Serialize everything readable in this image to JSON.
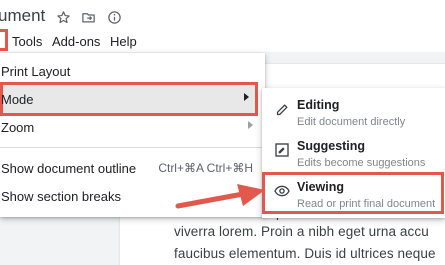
{
  "title_bar": {
    "doc_title": "ument",
    "icons": [
      "star-icon",
      "move-to-folder-icon",
      "document-status-icon"
    ]
  },
  "menu_bar": {
    "items": [
      "Tools",
      "Add-ons",
      "Help"
    ]
  },
  "view_menu": {
    "items": [
      {
        "label": "Print Layout"
      },
      {
        "label": "Mode",
        "has_submenu": true,
        "selected": true
      },
      {
        "label": "Zoom",
        "has_submenu": true
      },
      {
        "label": "Show document outline",
        "shortcut": "Ctrl+⌘A Ctrl+⌘H"
      },
      {
        "label": "Show section breaks"
      }
    ]
  },
  "mode_submenu": {
    "items": [
      {
        "icon": "pencil-icon",
        "title": "Editing",
        "desc": "Edit document directly"
      },
      {
        "icon": "suggest-edit-icon",
        "title": "Suggesting",
        "desc": "Edits become suggestions"
      },
      {
        "icon": "eye-icon",
        "title": "Viewing",
        "desc": "Read or print final document"
      }
    ]
  },
  "document": {
    "lines": [
      "viverra lorem. Proin a nibh eget urna accu",
      "faucibus elementum. Duis id ultrices neque"
    ],
    "partial_char": "r"
  },
  "colors": {
    "highlight_border": "#e2584c",
    "menu_selected_bg": "#e8e8e8"
  }
}
